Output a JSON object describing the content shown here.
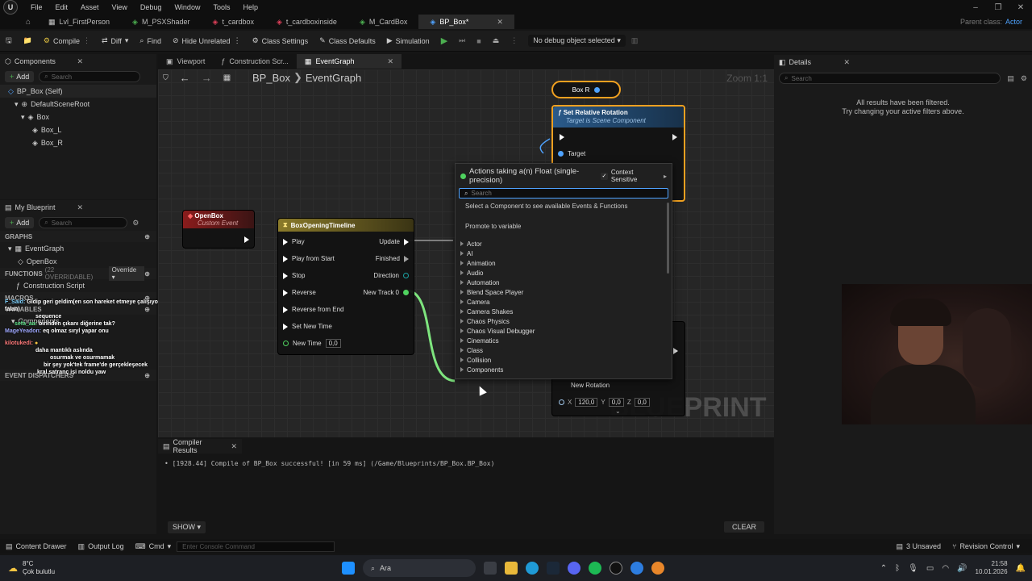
{
  "menu": {
    "items": [
      "File",
      "Edit",
      "Asset",
      "View",
      "Debug",
      "Window",
      "Tools",
      "Help"
    ]
  },
  "tabs": [
    {
      "label": "Lvl_FirstPerson"
    },
    {
      "label": "M_PSXShader"
    },
    {
      "label": "t_cardbox"
    },
    {
      "label": "t_cardboxinside"
    },
    {
      "label": "M_CardBox"
    },
    {
      "label": "BP_Box*"
    }
  ],
  "parent_class": {
    "label": "Parent class:",
    "value": "Actor"
  },
  "toolbar": {
    "compile": "Compile",
    "diff": "Diff",
    "find": "Find",
    "hide_unrelated": "Hide Unrelated",
    "class_settings": "Class Settings",
    "class_defaults": "Class Defaults",
    "simulation": "Simulation",
    "debug_object": "No debug object selected"
  },
  "components": {
    "title": "Components",
    "add": "Add",
    "search": "Search",
    "items": [
      "BP_Box (Self)",
      "DefaultSceneRoot",
      "Box",
      "Box_L",
      "Box_R"
    ]
  },
  "my_blueprint": {
    "title": "My Blueprint",
    "add": "Add",
    "search": "Search",
    "graphs": "GRAPHS",
    "event_graph": "EventGraph",
    "open_box": "OpenBox",
    "functions": "FUNCTIONS",
    "functions_count": "(22 OVERRIDABLE)",
    "override": "Override",
    "construction_script": "Construction Script",
    "macros": "MACROS",
    "variables": "VARIABLES",
    "components": "Components",
    "event_dispatchers": "EVENT DISPATCHERS"
  },
  "editor_tabs": {
    "viewport": "Viewport",
    "construction": "Construction Scr...",
    "event_graph": "EventGraph"
  },
  "breadcrumb": {
    "bp": "BP_Box",
    "graph": "EventGraph"
  },
  "zoom": "Zoom 1:1",
  "watermark": "BLUEPRINT",
  "nodes": {
    "open_box": {
      "title": "OpenBox",
      "subtitle": "Custom Event"
    },
    "timeline": {
      "title": "BoxOpeningTimeline",
      "inputs": [
        "Play",
        "Play from Start",
        "Stop",
        "Reverse",
        "Reverse from End",
        "Set New Time"
      ],
      "new_time": "New Time",
      "new_time_value": "0,0",
      "outputs": [
        "Update",
        "Finished",
        "Direction",
        "New Track 0"
      ]
    },
    "box_r": {
      "title": "Box R"
    },
    "set_rotation": {
      "title": "Set Relative Rotation",
      "subtitle": "Target is Scene Component",
      "target": "Target",
      "new_rotation": "New Rotation",
      "x": "120,0",
      "y": "0,0",
      "z": "0,0"
    }
  },
  "context_menu": {
    "title": "Actions taking a(n) Float (single-precision)",
    "context_sensitive": "Context Sensitive",
    "search_placeholder": "Search",
    "hint": "Select a Component to see available Events & Functions",
    "promote": "Promote to variable",
    "categories": [
      "Actor",
      "AI",
      "Animation",
      "Audio",
      "Automation",
      "Blend Space Player",
      "Camera",
      "Camera Shakes",
      "Chaos Physics",
      "Chaos Visual Debugger",
      "Cinematics",
      "Class",
      "Collision",
      "Components"
    ]
  },
  "details": {
    "title": "Details",
    "search": "Search",
    "message_1": "All results have been filtered.",
    "message_2": "Try changing your active filters above."
  },
  "compiler": {
    "title": "Compiler Results",
    "message": "[1928.44] Compile of BP_Box successful! [in 59 ms] (/Game/Blueprints/BP_Box.BP_Box)",
    "show": "SHOW",
    "clear": "CLEAR"
  },
  "bottom_bar": {
    "content_drawer": "Content Drawer",
    "output_log": "Output Log",
    "cmd": "Cmd",
    "console_placeholder": "Enter Console Command",
    "unsaved": "3 Unsaved",
    "revision": "Revision Control"
  },
  "taskbar": {
    "temp": "8°C",
    "weather": "Çok bulutlu",
    "search": "Ara",
    "time": "21:58",
    "date": "10.01.2026"
  },
  "chat": [
    {
      "user": "F_Said:",
      "text": "Gidip geri geldim(en son hareket etmeye çalışıyordk 30 falan)"
    },
    {
      "user": "",
      "text": "sequence"
    },
    {
      "user": "sefa_aa:",
      "text": "birinden çıkanı diğerine tak?"
    },
    {
      "user": "MageYeadon:",
      "text": "eq olmaz sıryl yapar onu"
    },
    {
      "user": "kilotukedi:",
      "text": ""
    },
    {
      "user": "",
      "text": "daha mantıklı aslında"
    },
    {
      "user": "",
      "text": "osurmak ve osurmamak"
    },
    {
      "user": "",
      "text": "bir şey yok'tek frame'de gerçekleşecek"
    },
    {
      "user": "",
      "text": "kral satranç işi noldu yaw"
    }
  ]
}
